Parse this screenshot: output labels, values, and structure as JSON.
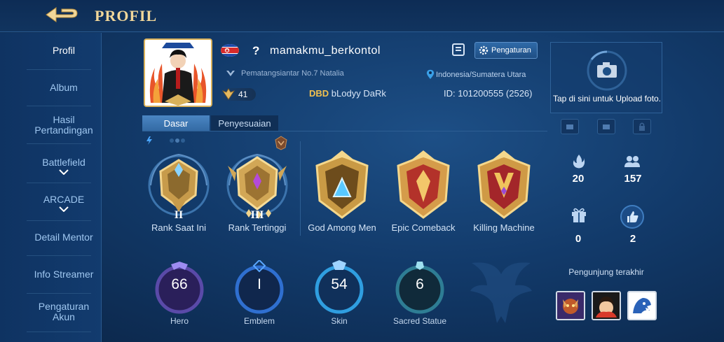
{
  "header": {
    "title": "PROFIL"
  },
  "sidebar": {
    "items": [
      {
        "label": "Profil"
      },
      {
        "label": "Album"
      },
      {
        "label": "Hasil Pertandingan"
      },
      {
        "label": "Battlefield"
      },
      {
        "label": "ARCADE"
      },
      {
        "label": "Detail Mentor"
      },
      {
        "label": "Info Streamer"
      },
      {
        "label": "Pengaturan Akun"
      }
    ]
  },
  "profile": {
    "question_mark": "?",
    "username": "mamakmu_berkontol",
    "settings_label": "Pengaturan",
    "location_left": "Pematangsiantar No.7 Natalia",
    "location_right": "Indonesia/Sumatera Utara",
    "level": "41",
    "squad_tag": "DBD",
    "squad_name": "bLodyy DaRk",
    "id_text": "ID: 101200555 (2526)"
  },
  "tabs": [
    {
      "label": "Dasar"
    },
    {
      "label": "Penyesuaian"
    }
  ],
  "medals": [
    {
      "label": "Rank Saat Ini",
      "roman": "II"
    },
    {
      "label": "Rank Tertinggi",
      "roman": "III"
    },
    {
      "label": "God Among Men"
    },
    {
      "label": "Epic Comeback"
    },
    {
      "label": "Killing Machine"
    }
  ],
  "stats": [
    {
      "label": "Hero",
      "value": "66"
    },
    {
      "label": "Emblem",
      "value": "I"
    },
    {
      "label": "Skin",
      "value": "54"
    },
    {
      "label": "Sacred Statue",
      "value": "6"
    }
  ],
  "right_panel": {
    "upload_text": "Tap di sini untuk Upload foto.",
    "stat_flame": "20",
    "stat_people": "157",
    "stat_gift": "0",
    "stat_like": "2",
    "visitors_label": "Pengunjung terakhir"
  },
  "colors": {
    "accent_gold": "#f1d79a",
    "squad_tag": "#f2c14e",
    "bg": "#123a6a"
  }
}
